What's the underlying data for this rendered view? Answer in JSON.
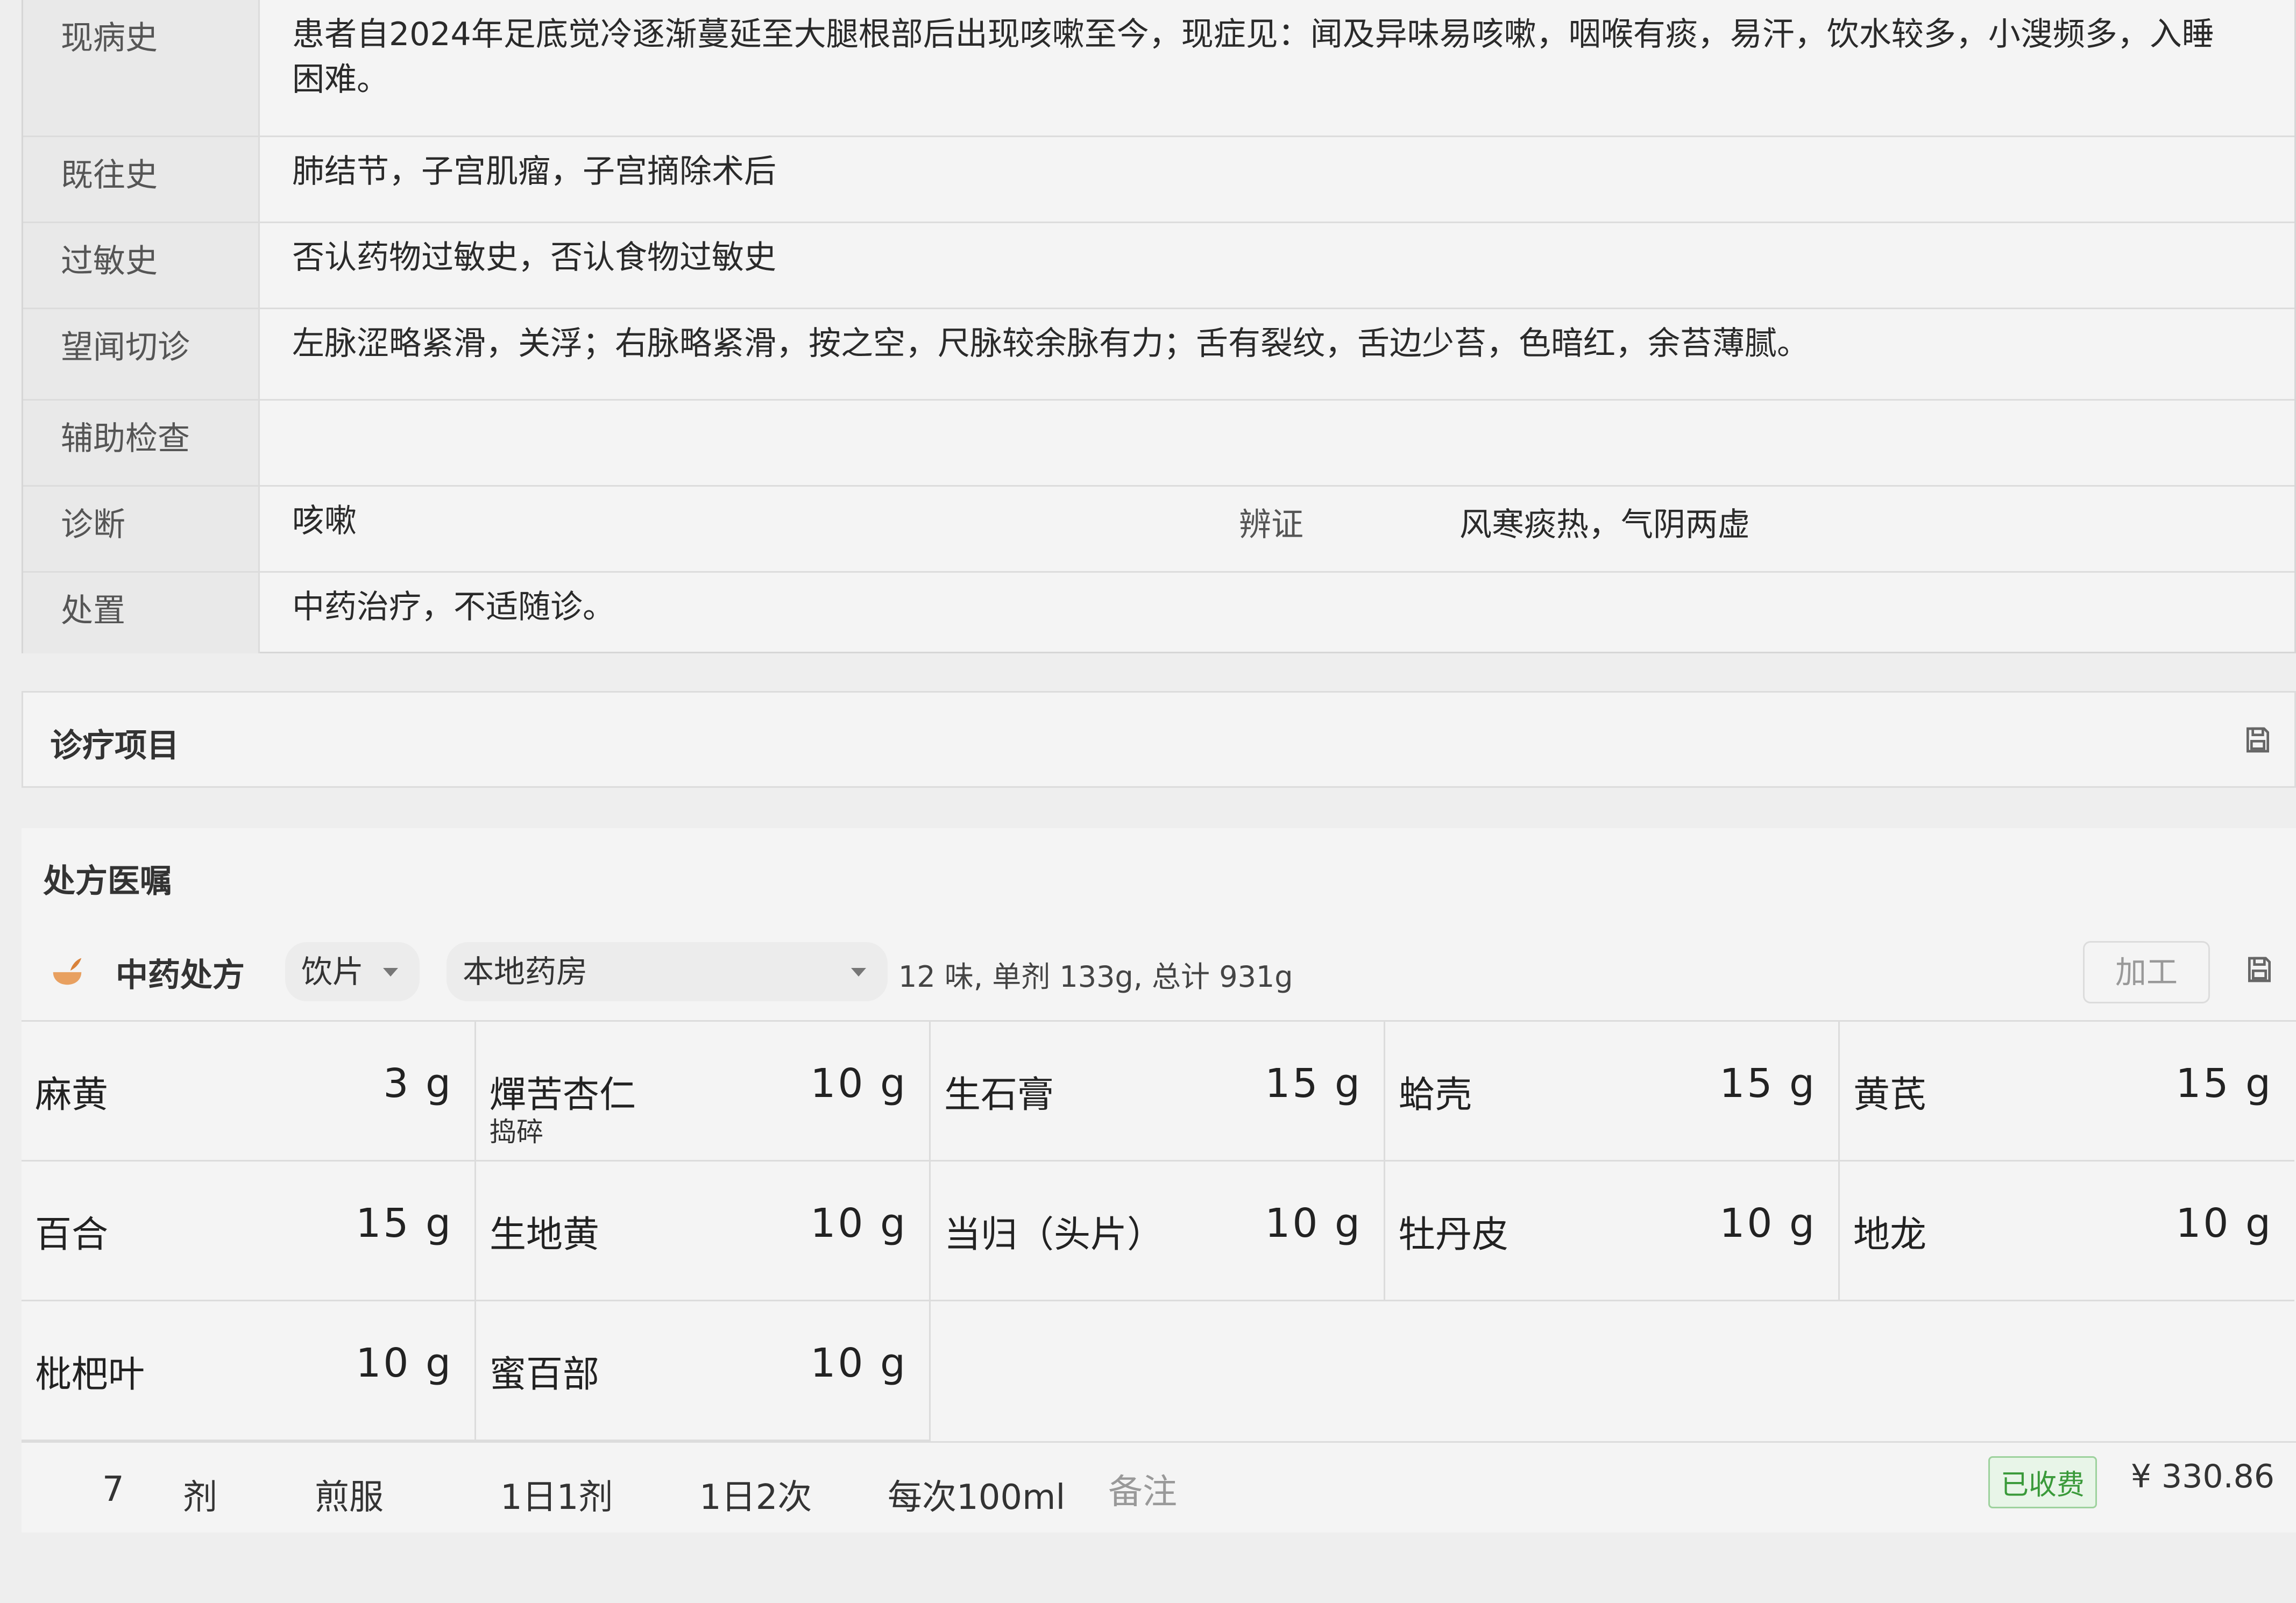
{
  "record": {
    "history_present_label": "现病史",
    "history_present_value": "患者自2024年足底觉冷逐渐蔓延至大腿根部后出现咳嗽至今，现症见：闻及异味易咳嗽，咽喉有痰，易汗，饮水较多，小溲频多，入睡困难。",
    "past_history_label": "既往史",
    "past_history_value": "肺结节，子宫肌瘤，子宫摘除术后",
    "allergy_label": "过敏史",
    "allergy_value": "否认药物过敏史，否认食物过敏史",
    "four_exam_label": "望闻切诊",
    "four_exam_value": "左脉涩略紧滑，关浮；右脉略紧滑，按之空，尺脉较余脉有力；舌有裂纹，舌边少苔，色暗红，余苔薄腻。",
    "aux_exam_label": "辅助检查",
    "aux_exam_value": "",
    "diagnosis_label": "诊断",
    "diagnosis_value": "咳嗽",
    "syndrome_label": "辨证",
    "syndrome_value": "风寒痰热，气阴两虚",
    "disposal_label": "处置",
    "disposal_value": "中药治疗，不适随诊。"
  },
  "treatment_items": {
    "title": "诊疗项目"
  },
  "prescription": {
    "title": "处方医嘱",
    "type_label": "中药处方",
    "form_select": "饮片",
    "pharmacy_select": "本地药房",
    "summary": "12 味, 单剂 133g, 总计 931g",
    "process_button": "加工",
    "herbs": [
      {
        "name": "麻黄",
        "dose": "3 g",
        "note": ""
      },
      {
        "name": "燀苦杏仁",
        "dose": "10 g",
        "note": "捣碎"
      },
      {
        "name": "生石膏",
        "dose": "15 g",
        "note": ""
      },
      {
        "name": "蛤壳",
        "dose": "15 g",
        "note": ""
      },
      {
        "name": "黄芪",
        "dose": "15 g",
        "note": ""
      },
      {
        "name": "百合",
        "dose": "15 g",
        "note": ""
      },
      {
        "name": "生地黄",
        "dose": "10 g",
        "note": ""
      },
      {
        "name": "当归（头片）",
        "dose": "10 g",
        "note": ""
      },
      {
        "name": "牡丹皮",
        "dose": "10 g",
        "note": ""
      },
      {
        "name": "地龙",
        "dose": "10 g",
        "note": ""
      },
      {
        "name": "枇杷叶",
        "dose": "10 g",
        "note": ""
      },
      {
        "name": "蜜百部",
        "dose": "10 g",
        "note": ""
      }
    ],
    "footer": {
      "doses": "7",
      "dose_unit": "剂",
      "method": "煎服",
      "daily_doses": "1日1剂",
      "daily_times": "1日2次",
      "per_time": "每次100ml",
      "remark": "备注",
      "status": "已收费",
      "price": "¥ 330.86"
    }
  }
}
